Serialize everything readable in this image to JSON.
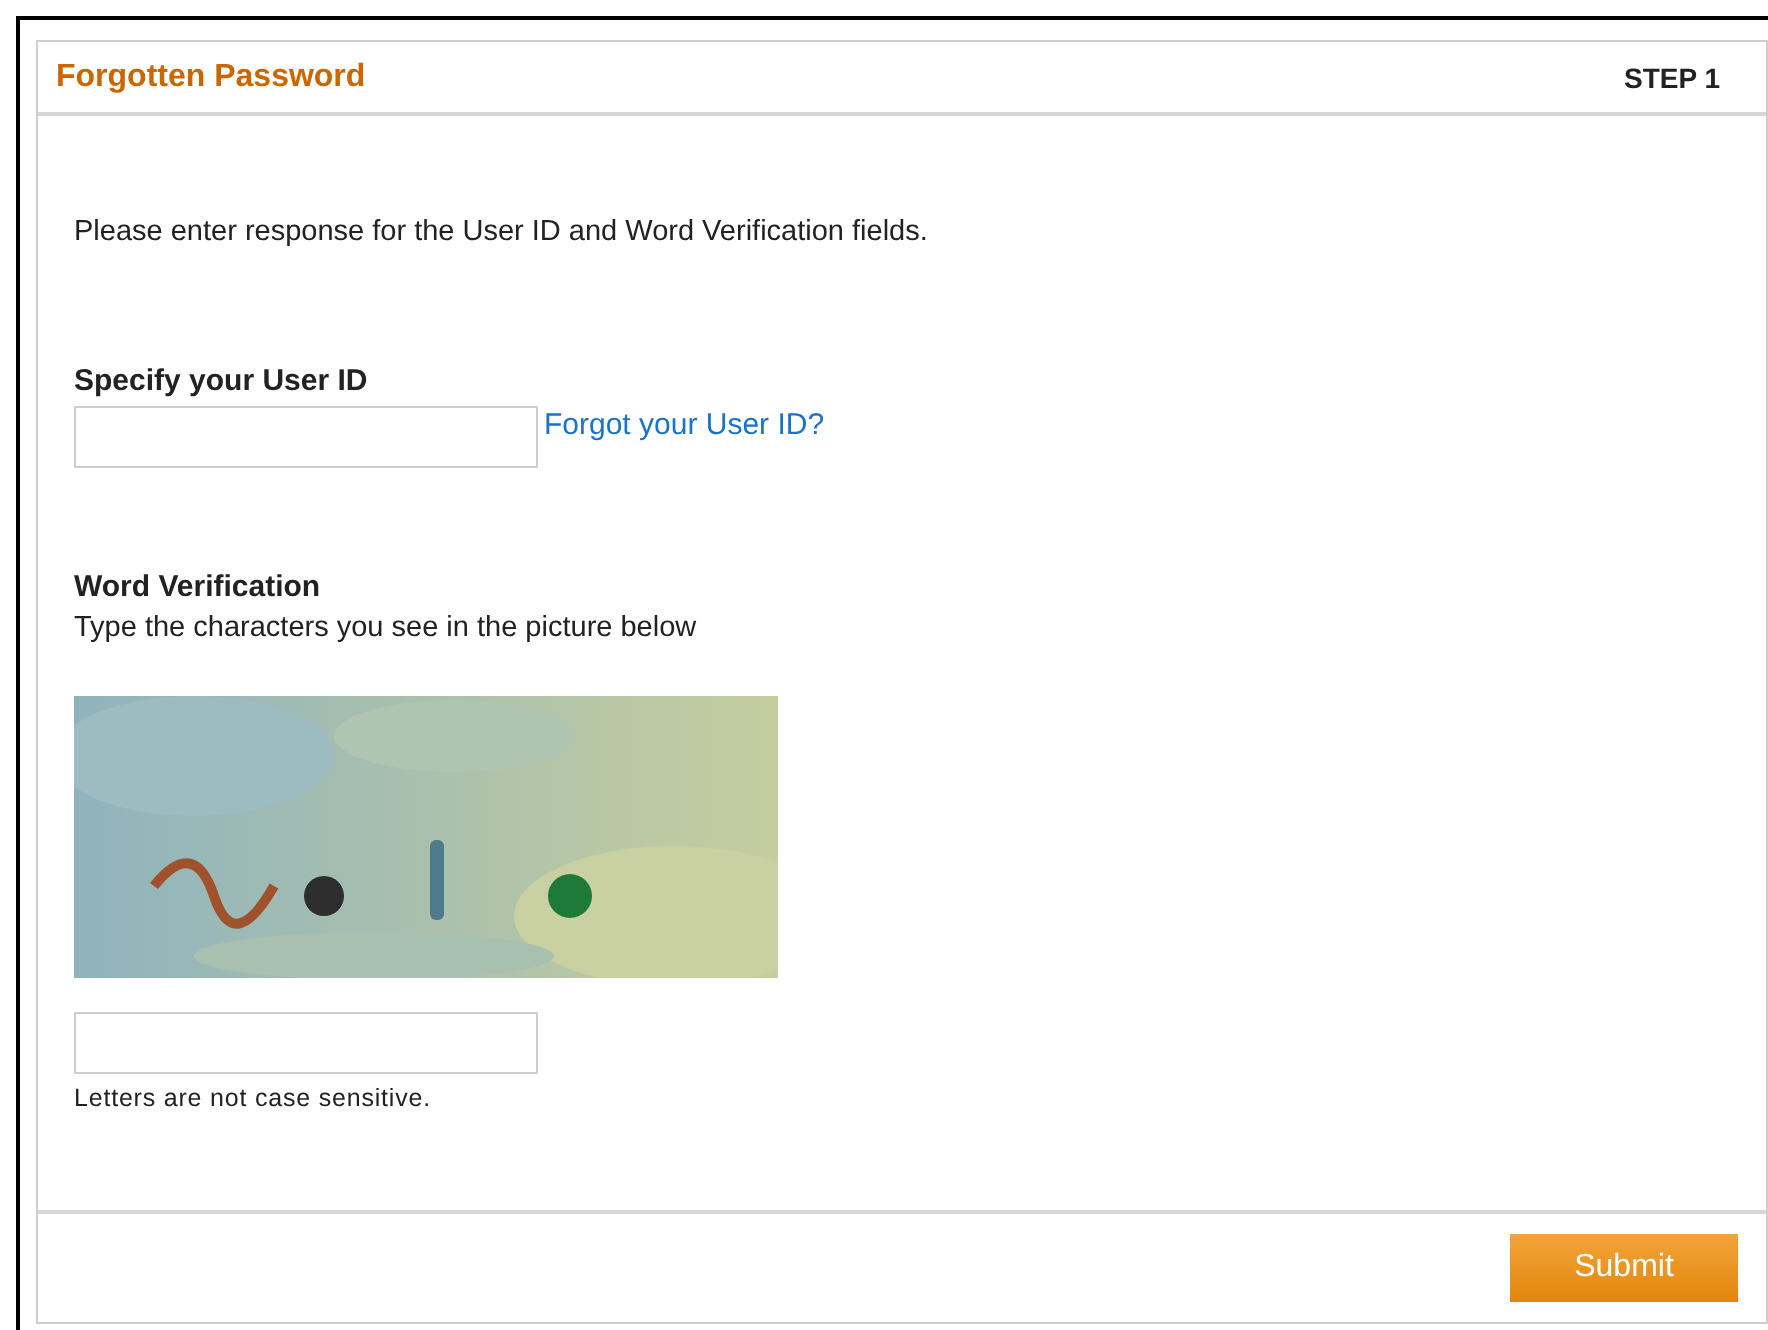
{
  "panel": {
    "title": "Forgotten Password",
    "step": "STEP 1"
  },
  "intro": "Please enter response for the User ID and Word Verification fields.",
  "user_id": {
    "label": "Specify your User ID",
    "link": "Forgot your User ID?"
  },
  "verification": {
    "label": "Word Verification",
    "hint": "Type the characters you see in the picture below",
    "note": "Letters are not case sensitive."
  },
  "buttons": [
    "Submit"
  ]
}
